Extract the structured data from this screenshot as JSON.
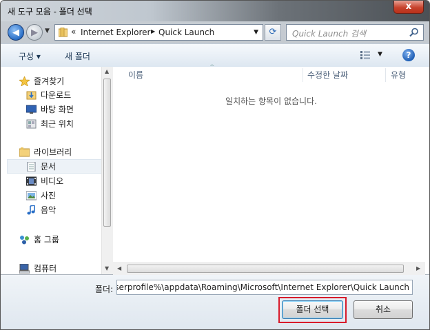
{
  "window": {
    "title": "새 도구 모음 - 폴더 선택",
    "close_glyph": "x"
  },
  "navbar": {
    "back_glyph": "◀",
    "forward_glyph": "▶",
    "address_chevron": "«",
    "address_segments": [
      "Internet Explorer",
      "Quick Launch"
    ],
    "search_placeholder": "Quick Launch 검색"
  },
  "toolbar": {
    "organize_label": "구성 ▾",
    "new_folder_label": "새 폴더",
    "help_glyph": "?"
  },
  "navpane": {
    "items": [
      {
        "label": "즐겨찾기",
        "icon": "star-icon"
      },
      {
        "label": "다운로드",
        "icon": "downloads-folder-icon"
      },
      {
        "label": "바탕 화면",
        "icon": "desktop-icon"
      },
      {
        "label": "최근 위치",
        "icon": "recent-places-icon"
      },
      {
        "label": "라이브러리",
        "icon": "libraries-icon"
      },
      {
        "label": "문서",
        "icon": "documents-icon"
      },
      {
        "label": "비디오",
        "icon": "videos-icon"
      },
      {
        "label": "사진",
        "icon": "pictures-icon"
      },
      {
        "label": "음악",
        "icon": "music-icon"
      },
      {
        "label": "홈 그룹",
        "icon": "homegroup-icon"
      },
      {
        "label": "컴퓨터",
        "icon": "computer-icon"
      }
    ],
    "selected": "문서"
  },
  "content": {
    "columns": [
      "이름",
      "수정한 날짜",
      "유형"
    ],
    "empty_message": "일치하는 항목이 없습니다."
  },
  "bottom": {
    "folder_label": "폴더:",
    "folder_value": "%userprofile%\\appdata\\Roaming\\Microsoft\\Internet Explorer\\Quick Launch",
    "select_folder_button": "폴더 선택",
    "cancel_button": "취소"
  },
  "colors": {
    "highlight_border": "#d81a2a",
    "selection_bg": "#edf2f7"
  }
}
